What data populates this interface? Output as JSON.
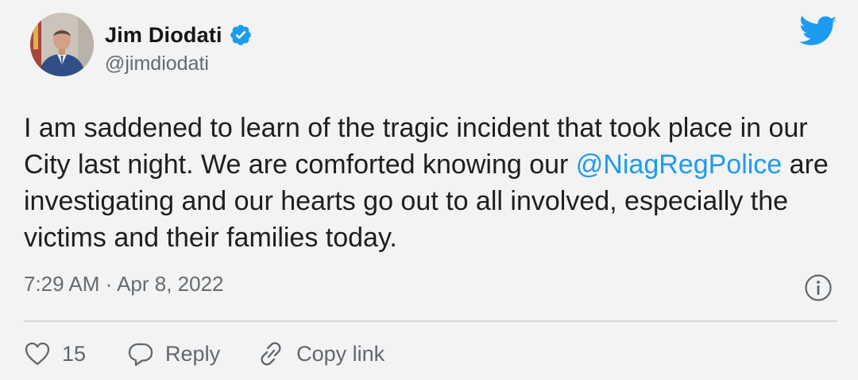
{
  "author": {
    "name": "Jim Diodati",
    "handle": "@jimdiodati"
  },
  "icons": {
    "verified": "verified-badge-icon",
    "brand": "twitter-bird-icon",
    "info": "info-icon",
    "like": "heart-icon",
    "reply": "speech-bubble-icon",
    "copy_link": "link-icon"
  },
  "tweet": {
    "text_part1": "I am saddened to learn of the tragic incident that took place in our City last night.  We are comforted knowing our ",
    "mention": "@NiagRegPolice",
    "text_part2": " are investigating and our hearts go out to all involved, especially the victims and their families today.",
    "timestamp": "7:29 AM · Apr 8, 2022"
  },
  "actions": {
    "like_count": "15",
    "reply_label": "Reply",
    "copy_link_label": "Copy link"
  },
  "colors": {
    "accent": "#1d9bf0",
    "text": "#1e1e1e",
    "secondary": "#646c73",
    "background": "#f3f3f3"
  }
}
